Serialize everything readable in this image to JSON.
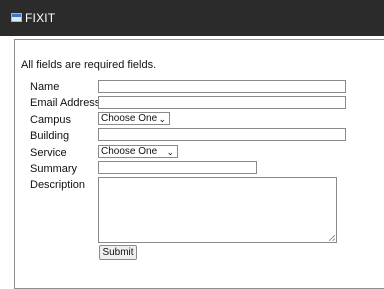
{
  "window": {
    "title": "FIXIT",
    "icon": "window-icon"
  },
  "form": {
    "required_note": "All fields are required fields.",
    "labels": {
      "name": "Name",
      "email": "Email Address",
      "campus": "Campus",
      "building": "Building",
      "service": "Service",
      "summary": "Summary",
      "description": "Description"
    },
    "values": {
      "name": "",
      "email": "",
      "building": "",
      "summary": "",
      "description": ""
    },
    "selects": {
      "campus": "Choose One",
      "service": "Choose One"
    },
    "submit_label": "Submit"
  }
}
